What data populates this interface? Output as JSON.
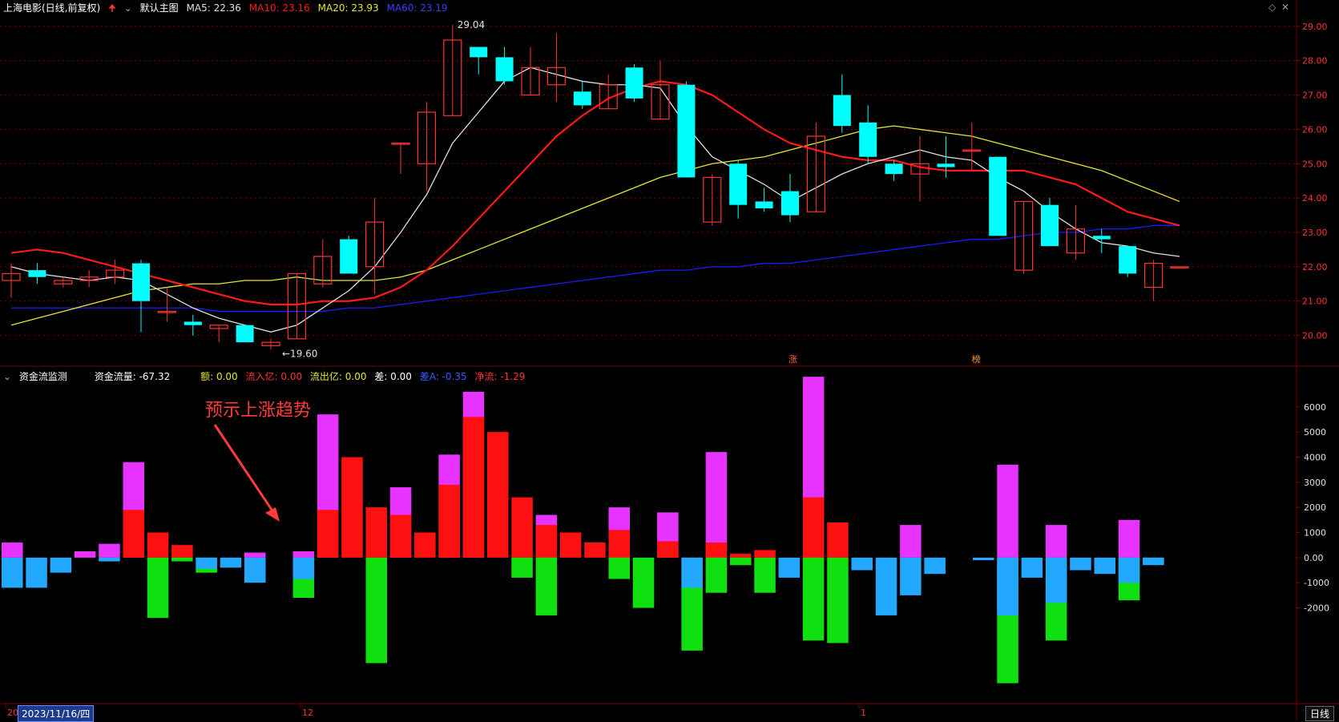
{
  "header": {
    "stock": "上海电影(日线,前复权)",
    "main_label": "默认主图",
    "ma5": "MA5: 22.36",
    "ma10": "MA10: 23.16",
    "ma20": "MA20: 23.93",
    "ma60": "MA60: 23.19"
  },
  "sub_header": {
    "title": "资金流监测",
    "flow": "资金流量: -67.32",
    "e": "额: 0.00",
    "inflow": "流入亿: 0.00",
    "outflow": "流出亿: 0.00",
    "diff": "差: 0.00",
    "diff_a": "差A: -0.35",
    "net": "净流: -1.29"
  },
  "annotation": "预示上涨趋势",
  "date_label": "2023/11/16/四",
  "period_label": "日线",
  "colors": {
    "up": "#ff3232",
    "down": "#00ffff",
    "ma5": "#e0e0e0",
    "ma10": "#ff1a1a",
    "ma20": "#e6e632",
    "ma60": "#1a1aff",
    "grid": "#7a0000",
    "text": "#c8c8c8"
  },
  "chart_data": [
    {
      "type": "candlestick",
      "ylim": [
        19.5,
        29.3
      ],
      "y_ticks": [
        "29.00",
        "28.00",
        "27.00",
        "26.00",
        "25.00",
        "24.00",
        "23.00",
        "22.00",
        "21.00",
        "20.00"
      ],
      "x_tick_labels": [
        "20",
        "12",
        "1"
      ],
      "max_label": "29.04",
      "min_label": "19.60",
      "markers": [
        "涨",
        "榜"
      ],
      "candles": [
        [
          21.6,
          21.8,
          21.1,
          22.1
        ],
        [
          21.9,
          21.7,
          21.5,
          22.1
        ],
        [
          21.5,
          21.6,
          21.4,
          21.7
        ],
        [
          21.6,
          21.7,
          21.4,
          21.9
        ],
        [
          21.7,
          21.9,
          21.5,
          22.2
        ],
        [
          22.1,
          21.0,
          20.1,
          22.2
        ],
        [
          20.7,
          20.7,
          20.4,
          21.4
        ],
        [
          20.4,
          20.3,
          20.0,
          20.6
        ],
        [
          20.2,
          20.3,
          19.8,
          20.3
        ],
        [
          20.3,
          19.8,
          19.8,
          20.3
        ],
        [
          19.7,
          19.8,
          19.6,
          19.9
        ],
        [
          19.9,
          21.8,
          19.9,
          21.8
        ],
        [
          21.5,
          22.3,
          21.4,
          22.8
        ],
        [
          22.8,
          21.8,
          21.8,
          22.9
        ],
        [
          22.0,
          23.3,
          21.2,
          24.0
        ],
        [
          25.6,
          25.6,
          24.7,
          25.6
        ],
        [
          25.0,
          26.5,
          24.2,
          26.8
        ],
        [
          26.4,
          28.6,
          26.4,
          29.04
        ],
        [
          28.4,
          28.1,
          27.6,
          28.4
        ],
        [
          28.1,
          27.4,
          27.3,
          28.4
        ],
        [
          27.0,
          27.8,
          27.0,
          28.4
        ],
        [
          27.3,
          27.8,
          26.8,
          28.8
        ],
        [
          27.1,
          26.7,
          26.6,
          27.4
        ],
        [
          26.6,
          27.3,
          26.6,
          27.6
        ],
        [
          27.8,
          26.9,
          26.8,
          27.9
        ],
        [
          26.3,
          27.3,
          26.3,
          28.0
        ],
        [
          27.3,
          24.6,
          24.6,
          27.4
        ],
        [
          23.3,
          24.6,
          23.2,
          24.7
        ],
        [
          25.0,
          23.8,
          23.4,
          25.1
        ],
        [
          23.9,
          23.7,
          23.6,
          24.3
        ],
        [
          24.2,
          23.5,
          23.3,
          24.7
        ],
        [
          23.6,
          25.8,
          23.6,
          26.2
        ],
        [
          27.0,
          26.1,
          25.9,
          27.6
        ],
        [
          26.2,
          25.2,
          25.0,
          26.7
        ],
        [
          25.0,
          24.7,
          24.5,
          25.1
        ],
        [
          24.7,
          25.0,
          23.9,
          25.8
        ],
        [
          25.0,
          24.9,
          24.6,
          25.8
        ],
        [
          25.4,
          25.4,
          24.8,
          26.2
        ],
        [
          25.2,
          22.9,
          22.9,
          25.2
        ],
        [
          21.9,
          23.9,
          21.8,
          23.9
        ],
        [
          23.8,
          22.6,
          22.6,
          24.0
        ],
        [
          22.4,
          23.1,
          22.2,
          23.8
        ],
        [
          22.9,
          22.8,
          22.4,
          23.1
        ],
        [
          22.6,
          21.8,
          21.7,
          22.6
        ],
        [
          21.4,
          22.1,
          21.0,
          22.2
        ],
        [
          22.0,
          22.0,
          22.0,
          22.0
        ]
      ],
      "ma5": [
        22.0,
        21.8,
        21.7,
        21.6,
        21.7,
        21.6,
        21.2,
        20.8,
        20.5,
        20.3,
        20.1,
        20.3,
        20.8,
        21.3,
        22.0,
        23.0,
        24.1,
        25.6,
        26.5,
        27.4,
        27.8,
        27.6,
        27.4,
        27.3,
        27.3,
        27.2,
        26.1,
        25.2,
        24.8,
        24.4,
        23.9,
        24.3,
        24.7,
        25.0,
        25.2,
        25.4,
        25.2,
        25.1,
        24.6,
        24.2,
        23.6,
        23.1,
        22.7,
        22.6,
        22.4,
        22.3
      ],
      "ma10": [
        22.4,
        22.5,
        22.4,
        22.2,
        22.0,
        21.8,
        21.6,
        21.4,
        21.2,
        21.0,
        20.9,
        20.9,
        21.0,
        21.0,
        21.1,
        21.4,
        21.9,
        22.6,
        23.4,
        24.2,
        25.0,
        25.8,
        26.4,
        26.9,
        27.2,
        27.4,
        27.3,
        27.0,
        26.5,
        26.0,
        25.6,
        25.4,
        25.2,
        25.1,
        25.1,
        24.9,
        24.8,
        24.8,
        24.8,
        24.8,
        24.6,
        24.4,
        24.0,
        23.6,
        23.4,
        23.2
      ],
      "ma20": [
        20.3,
        20.5,
        20.7,
        20.9,
        21.1,
        21.3,
        21.4,
        21.5,
        21.5,
        21.6,
        21.6,
        21.7,
        21.6,
        21.6,
        21.6,
        21.7,
        21.9,
        22.2,
        22.5,
        22.8,
        23.1,
        23.4,
        23.7,
        24.0,
        24.3,
        24.6,
        24.8,
        25.0,
        25.1,
        25.2,
        25.4,
        25.6,
        25.8,
        26.0,
        26.1,
        26.0,
        25.9,
        25.8,
        25.6,
        25.4,
        25.2,
        25.0,
        24.8,
        24.5,
        24.2,
        23.9
      ],
      "ma60": [
        20.8,
        20.8,
        20.8,
        20.8,
        20.8,
        20.8,
        20.8,
        20.8,
        20.7,
        20.7,
        20.7,
        20.7,
        20.7,
        20.8,
        20.8,
        20.9,
        21.0,
        21.1,
        21.2,
        21.3,
        21.4,
        21.5,
        21.6,
        21.7,
        21.8,
        21.9,
        21.9,
        22.0,
        22.0,
        22.1,
        22.1,
        22.2,
        22.3,
        22.4,
        22.5,
        22.6,
        22.7,
        22.8,
        22.8,
        22.9,
        23.0,
        23.0,
        23.1,
        23.1,
        23.2,
        23.2
      ]
    },
    {
      "type": "bar",
      "ylim": [
        -5300,
        7300
      ],
      "y_ticks": [
        "6000",
        "5000",
        "4000",
        "3000",
        "2000",
        "1000",
        "0.00",
        "-1000",
        "-2000"
      ],
      "magenta": [
        600,
        0,
        0,
        250,
        550,
        3800,
        0,
        0,
        0,
        0,
        200,
        0,
        250,
        5700,
        0,
        0,
        2800,
        0,
        4100,
        6600,
        0,
        0,
        1700,
        0,
        0,
        2000,
        0,
        1800,
        0,
        4200,
        0,
        0,
        0,
        7200,
        0,
        0,
        0,
        1300,
        0,
        0,
        0,
        3700,
        0,
        1300,
        0,
        0,
        1500,
        0
      ],
      "red": [
        0,
        0,
        0,
        0,
        0,
        1900,
        1000,
        500,
        0,
        0,
        0,
        0,
        0,
        1900,
        4000,
        2000,
        1700,
        1000,
        2900,
        5600,
        5000,
        2400,
        1300,
        1000,
        600,
        1100,
        0,
        650,
        0,
        600,
        150,
        300,
        0,
        2400,
        1400,
        0,
        0,
        0,
        0,
        0,
        0,
        0,
        0,
        0,
        0,
        0,
        0,
        0
      ],
      "blue": [
        -1200,
        -1200,
        -600,
        0,
        -150,
        0,
        0,
        0,
        -450,
        -400,
        -1000,
        0,
        -850,
        0,
        0,
        0,
        0,
        0,
        0,
        0,
        0,
        0,
        0,
        0,
        0,
        0,
        0,
        0,
        -1200,
        0,
        0,
        0,
        -800,
        0,
        0,
        -500,
        -2300,
        -1500,
        -650,
        0,
        -100,
        -2300,
        -800,
        -1800,
        -500,
        -650,
        -1000,
        -300
      ],
      "green": [
        0,
        0,
        0,
        0,
        0,
        0,
        -2400,
        -150,
        -600,
        0,
        0,
        0,
        -1600,
        0,
        0,
        -4200,
        0,
        0,
        0,
        0,
        0,
        -800,
        -2300,
        0,
        0,
        -850,
        -2000,
        0,
        -3700,
        -1400,
        -300,
        -1400,
        0,
        -3300,
        -3400,
        0,
        0,
        0,
        0,
        0,
        0,
        -5000,
        0,
        -3300,
        0,
        0,
        -1700,
        -100
      ]
    }
  ]
}
